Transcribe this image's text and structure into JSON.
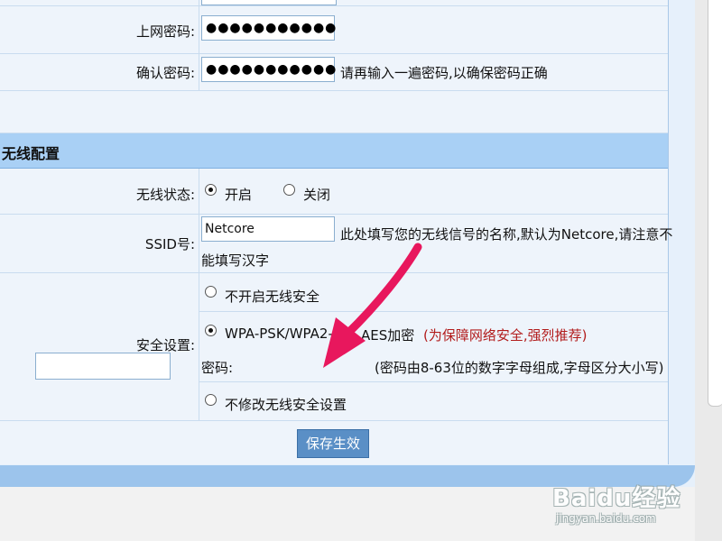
{
  "form": {
    "password_label": "上网密码:",
    "password_value": "●●●●●●●●●●●",
    "confirm_label": "确认密码:",
    "confirm_value": "●●●●●●●●●●●",
    "confirm_hint": "请再输入一遍密码,以确保密码正确"
  },
  "wireless": {
    "section_title": "无线配置",
    "status_label": "无线状态:",
    "status_on": "开启",
    "status_off": "关闭",
    "ssid_label": "SSID号:",
    "ssid_value": "Netcore",
    "ssid_hint_line1": "此处填写您的无线信号的名称,默认为Netcore,请注意不",
    "ssid_hint_line2": "能填写汉字",
    "security_label": "安全设置:",
    "opt_none": "不开启无线安全",
    "opt_wpa_a": "WPA-PSK/WPA2-",
    "opt_wpa_b": "AES加密",
    "opt_wpa_note": "(为保障网络安全,强烈推荐)",
    "key_label": "密码:",
    "key_hint": "(密码由8-63位的数字字母组成,字母区分大小写)",
    "opt_keep": "不修改无线安全设置",
    "save_button": "保存生效"
  },
  "watermark": {
    "logo": "Baidu经验",
    "url": "jingyan.baidu.com"
  },
  "colors": {
    "section_bg": "#a9d0f5",
    "accent_red": "#b21c1c",
    "arrow": "#e8175d",
    "button": "#5a8fc6"
  }
}
